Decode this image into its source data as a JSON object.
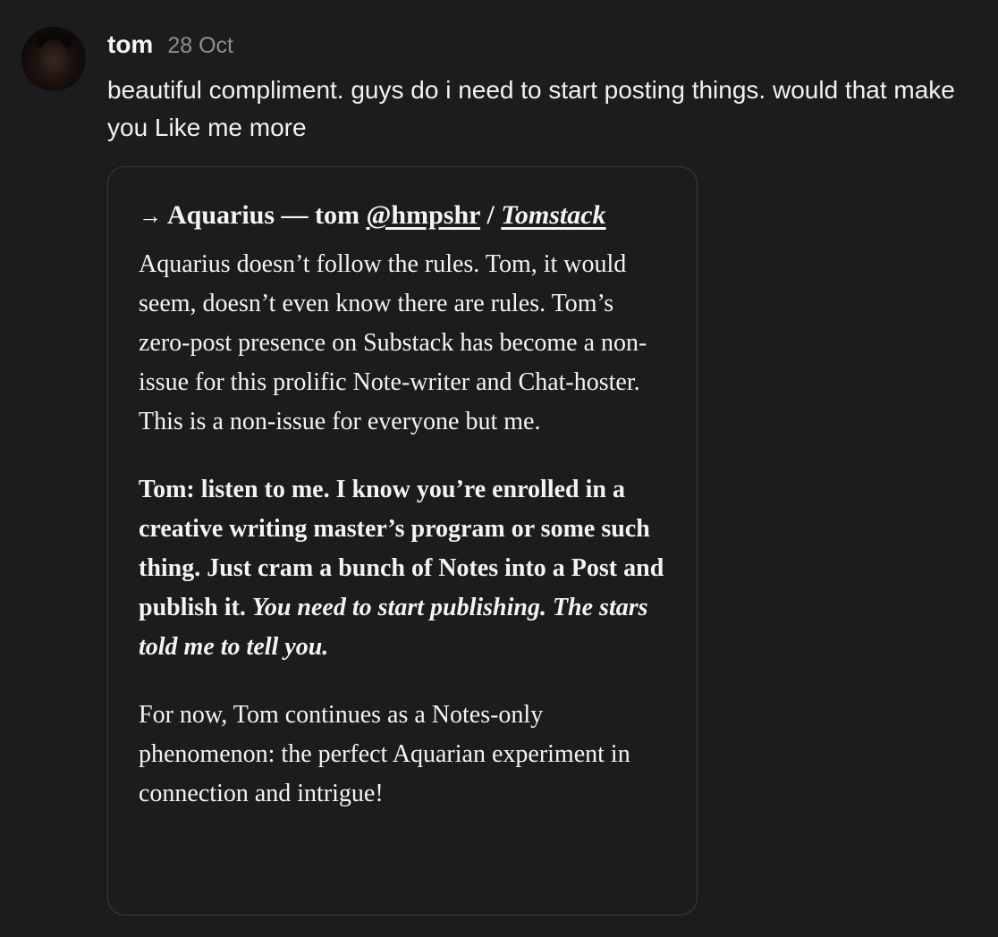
{
  "comment": {
    "author": "tom",
    "date": "28 Oct",
    "text": "beautiful compliment. guys do i need to start posting things. would that make you Like me more"
  },
  "quote": {
    "arrow": "→",
    "title_prefix": "Aquarius — tom ",
    "handle": "@hmpshr",
    "separator": " / ",
    "publication": "Tomstack",
    "paragraph1": "Aquarius doesn’t follow the rules. Tom, it would seem, doesn’t even know there are rules. Tom’s zero-post presence on Substack has become a non-issue for this prolific Note-writer and Chat-hoster. This is a non-issue for everyone but me.",
    "paragraph2_bold": "Tom: listen to me. I know you’re enrolled in a creative writing master’s program or some such thing. Just cram a bunch of Notes into a Post and publish it. ",
    "paragraph2_italic": "You need to start publishing. The stars told me to tell you.",
    "paragraph3": "For now, Tom continues as a Notes-only phenomenon: the perfect Aquarian experiment in connection and intrigue!"
  }
}
